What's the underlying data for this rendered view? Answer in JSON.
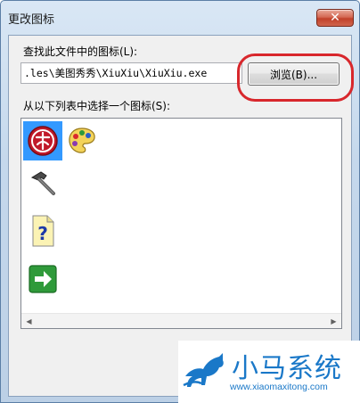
{
  "window": {
    "title": "更改图标",
    "close_symbol": "✕"
  },
  "file_section": {
    "label": "查找此文件中的图标(L):",
    "path_value": ".les\\美图秀秀\\XiuXiu\\XiuXiu.exe",
    "browse_label": "浏览(B)..."
  },
  "list_section": {
    "label": "从以下列表中选择一个图标(S):",
    "icons": [
      {
        "name": "xiuxiu-red-icon",
        "selected": true
      },
      {
        "name": "palette-icon",
        "selected": false
      },
      {
        "name": "hammer-icon",
        "selected": false
      },
      {
        "name": "help-document-icon",
        "selected": false
      },
      {
        "name": "green-arrow-icon",
        "selected": false
      }
    ],
    "scroll_left": "◀",
    "scroll_right": "▶"
  },
  "watermark": {
    "brand": "小马系统",
    "url": "www.xiaomaxitong.com"
  },
  "colors": {
    "selection": "#3399ff",
    "highlight": "#d8272c",
    "brand": "#1a78c8"
  }
}
